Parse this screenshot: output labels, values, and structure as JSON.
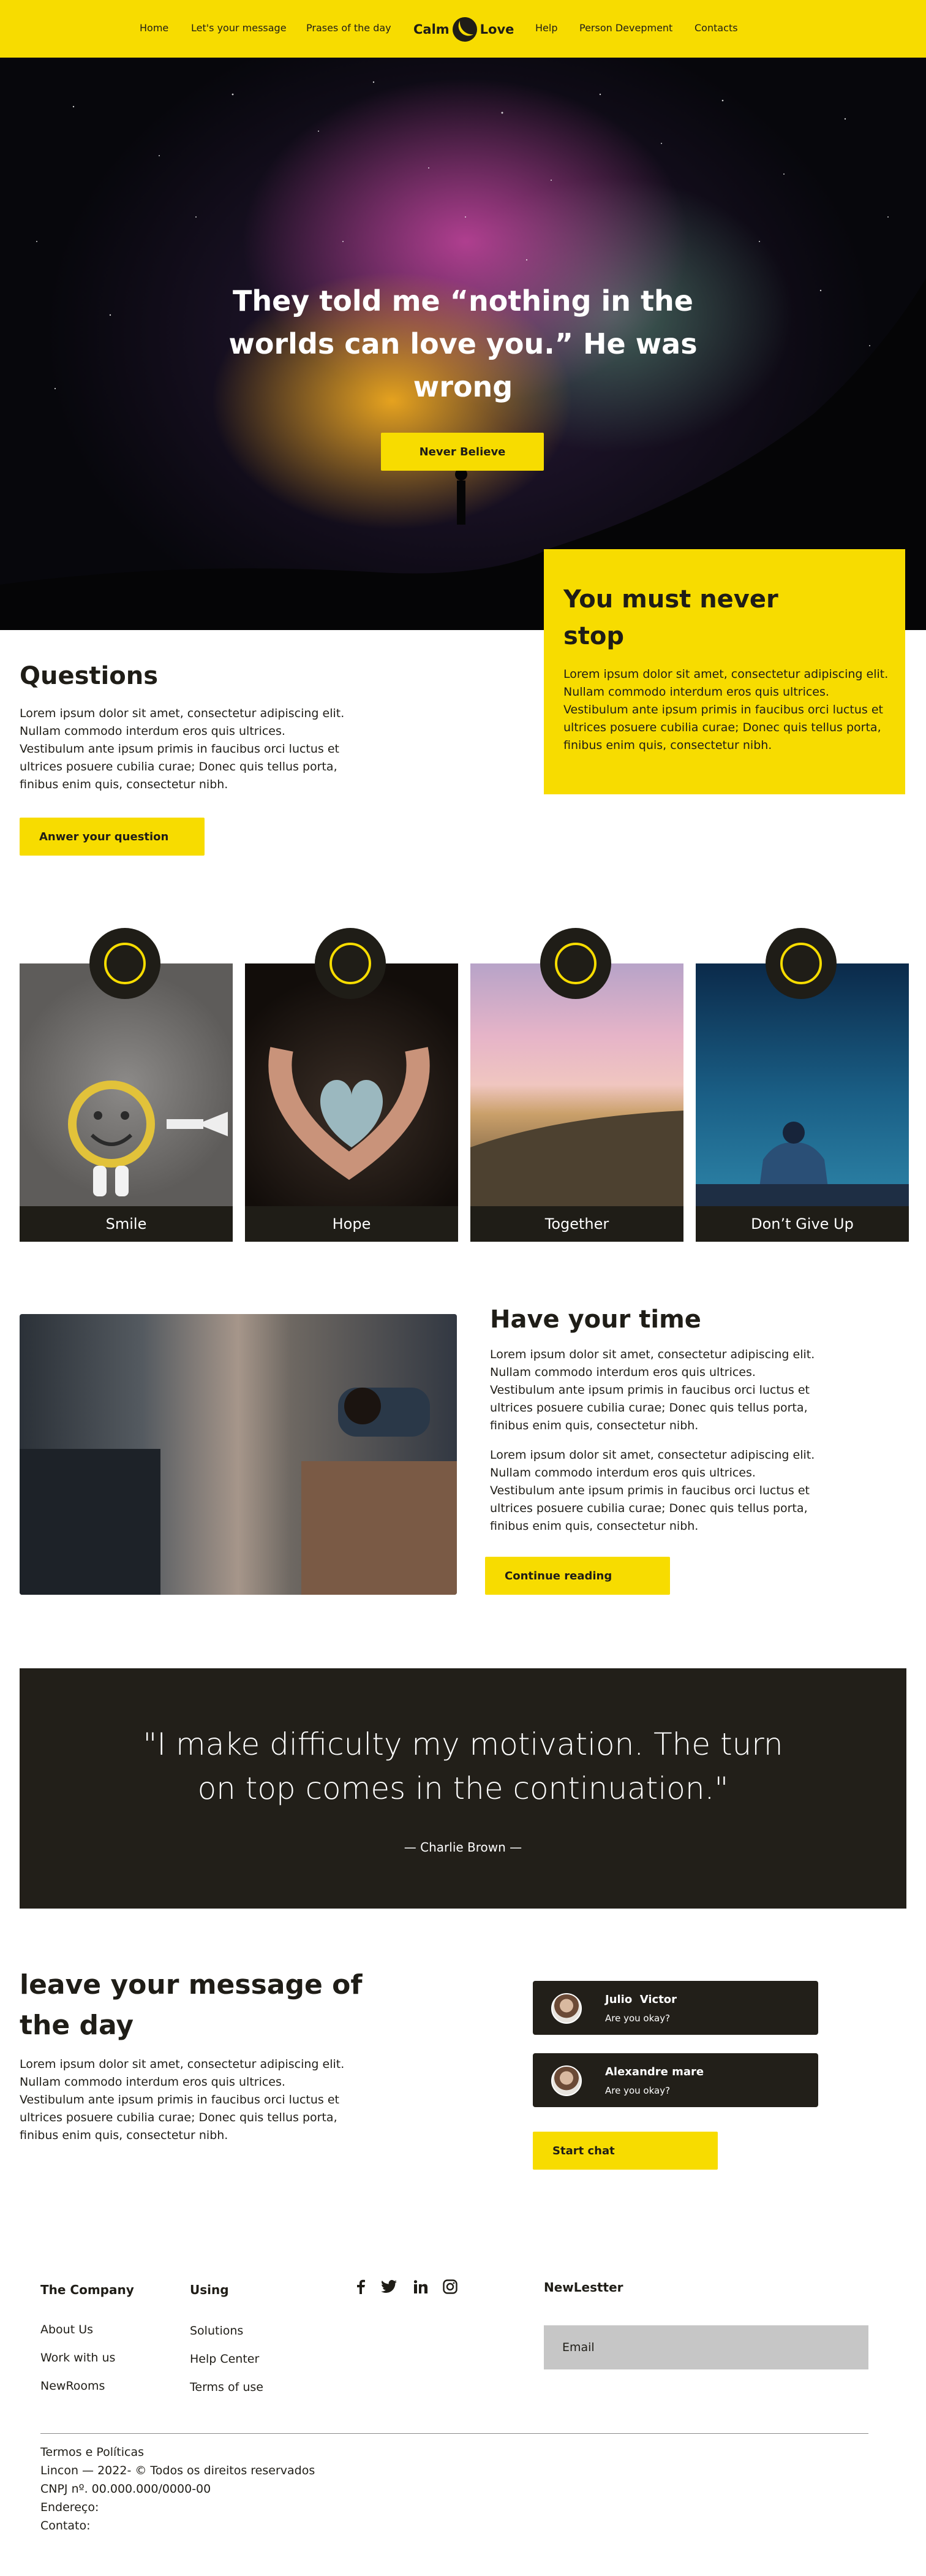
{
  "nav": {
    "links": [
      "Home",
      "Let's your message",
      "Prases of the day",
      "Help",
      "Person Devepment",
      "Contacts"
    ],
    "logo_left": "Calm",
    "logo_right": "Love"
  },
  "hero": {
    "title": "They told me  “nothing in the worlds can love you.” He was wrong",
    "button": "Never Believe"
  },
  "never_box": {
    "title": "You must never stop",
    "text": "Lorem ipsum dolor sit amet, consectetur adipiscing elit. Nullam commodo interdum eros quis ultrices. Vestibulum ante ipsum primis in faucibus orci luctus et ultrices posuere cubilia curae; Donec quis tellus porta, finibus enim quis, consectetur nibh."
  },
  "questions": {
    "title": "Questions",
    "text": "Lorem ipsum dolor sit amet, consectetur adipiscing elit. Nullam commodo interdum eros quis ultrices. Vestibulum ante ipsum primis in faucibus orci luctus et ultrices posuere cubilia curae; Donec quis tellus porta, finibus enim quis, consectetur nibh.",
    "button": "Anwer your question"
  },
  "cards": [
    "Smile",
    "Hope",
    "Together",
    "Don’t Give Up"
  ],
  "time_section": {
    "title": "Have your time",
    "text1": "Lorem ipsum dolor sit amet, consectetur adipiscing elit. Nullam commodo interdum eros quis ultrices. Vestibulum ante ipsum primis in faucibus orci luctus et ultrices posuere cubilia curae; Donec quis tellus porta, finibus enim quis, consectetur nibh.",
    "text2": "Lorem ipsum dolor sit amet, consectetur adipiscing elit. Nullam commodo interdum eros quis ultrices. Vestibulum ante ipsum primis in faucibus orci luctus et ultrices posuere cubilia curae; Donec quis tellus porta, finibus enim quis, consectetur nibh.",
    "button": "Continue reading"
  },
  "quote": {
    "text": "\"I make difficulty my motivation. The turn on top comes in the continuation.\"",
    "author": "— Charlie Brown —"
  },
  "message": {
    "title": "leave your message of the day",
    "text": "Lorem ipsum dolor sit amet, consectetur adipiscing elit. Nullam commodo interdum eros quis ultrices. Vestibulum ante ipsum primis in faucibus orci luctus et ultrices posuere cubilia curae; Donec quis tellus porta, finibus enim quis, consectetur nibh."
  },
  "chats": [
    {
      "name": "Julio  Victor",
      "status": "Are you okay?"
    },
    {
      "name": "Alexandre mare",
      "status": "Are you okay?"
    }
  ],
  "chat_button": "Start chat",
  "footer": {
    "company_title": "The Company",
    "company_links": [
      "About Us",
      "Work with us",
      "NewRooms"
    ],
    "using_title": "Using",
    "using_links": [
      "Solutions",
      "Help Center",
      "Terms of use"
    ],
    "newsletter_title": "NewLestter",
    "email_placeholder": "Email",
    "legal": [
      "Termos e Políticas",
      "Lincon — 2022- © Todos os direitos reservados",
      "CNPJ nº. 00.000.000/0000-00",
      "Endereço:",
      "Contato:"
    ]
  },
  "colors": {
    "accent": "#f7dc00",
    "dark": "#221f19"
  },
  "icons": [
    "facebook-icon",
    "twitter-icon",
    "linkedin-icon",
    "instagram-icon"
  ]
}
